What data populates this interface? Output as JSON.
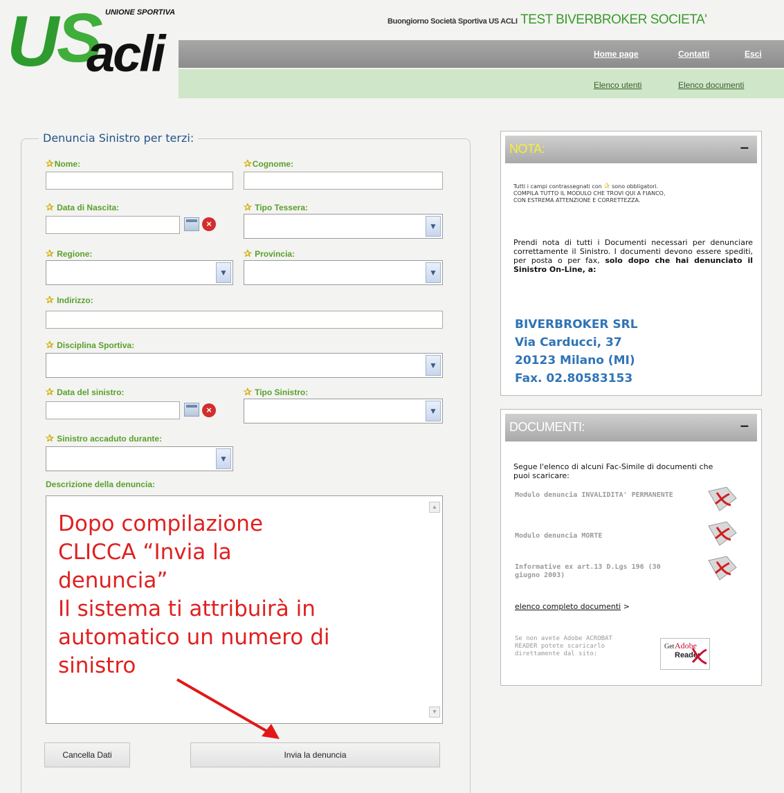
{
  "header": {
    "logo": {
      "unione": "UNIONE SPORTIVA",
      "u": "U",
      "s": "S",
      "acli": "acli"
    },
    "greeting_small": "Buongiorno Società Sportiva US ACLI",
    "greeting_big": "TEST BIVERBROKER SOCIETA'",
    "nav_top": [
      "Home page",
      "Contatti",
      "Esci"
    ],
    "nav_bottom": [
      "Elenco utenti",
      "Elenco documenti"
    ]
  },
  "form": {
    "legend": "Denuncia Sinistro per terzi:",
    "labels": {
      "nome": "Nome:",
      "cognome": "Cognome:",
      "data_nascita": "Data di Nascita:",
      "tipo_tessera": "Tipo Tessera:",
      "regione": "Regione:",
      "provincia": "Provincia:",
      "indirizzo": "Indirizzo:",
      "disciplina": "Disciplina Sportiva:",
      "data_sinistro": "Data del sinistro:",
      "tipo_sinistro": "Tipo Sinistro:",
      "accaduto": "Sinistro accaduto durante:",
      "descrizione": "Descrizione della denuncia:"
    },
    "star": "✰",
    "clear_glyph": "×",
    "arrow_glyph": "▼",
    "overlay_text": [
      "Dopo compilazione",
      "CLICCA “Invia la",
      "denuncia”",
      "Il sistema ti attribuirà in",
      "automatico un numero di",
      "sinistro"
    ],
    "buttons": {
      "cancel": "Cancella Dati",
      "submit": "Invia la denuncia"
    }
  },
  "nota": {
    "title": "NOTA:",
    "collapse": "–",
    "required_line1": "Tutti i campi contrassegnati con",
    "required_line1b": "sono obbligatori.",
    "required_line2": "COMPILA TUTTO IL MODULO CHE TROVI QUI A FIANCO,",
    "required_line3": "CON ESTREMA ATTENZIONE E CORRETTEZZA.",
    "paragraph": "Prendi nota di tutti i Documenti necessari per denunciare correttamente il Sinistro. I documenti devono essere spediti, per posta o per fax,",
    "paragraph_bold": "solo dopo che hai denunciato il Sinistro On-Line",
    "paragraph_end": ", a:",
    "address": [
      "BIVERBROKER SRL",
      "Via Carducci, 37",
      "20123 Milano (MI)",
      "Fax. 02.80583153"
    ]
  },
  "documenti": {
    "title": "DOCUMENTI:",
    "collapse": "–",
    "intro": "Segue l'elenco di alcuni Fac-Simile di documenti che puoi scaricare:",
    "items": [
      "Modulo denuncia INVALIDITA' PERMANENTE",
      "Modulo denuncia MORTE",
      "Informative ex art.13 D.Lgs 196 (30 giugno 2003)"
    ],
    "full_list_link": "elenco completo documenti",
    "full_list_arrow": ">",
    "adobe_text": "Se non avete Adobe ACROBAT READER potete scaricarlo direttamente dal sito:",
    "adobe_get": "Get",
    "adobe_brand": "Adobe",
    "adobe_reader": "Reader"
  },
  "colors": {
    "accent_green": "#5aa02c",
    "title_blue": "#24528a",
    "overlay_red": "#e02020",
    "address_blue": "#2f74b6"
  }
}
